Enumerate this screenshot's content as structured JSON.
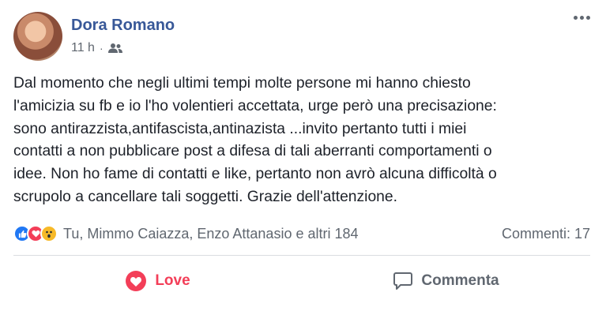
{
  "post": {
    "author": "Dora Romano",
    "time": "11 h",
    "separator": "·",
    "text": "Dal momento che negli ultimi tempi molte persone mi hanno chiesto\nl'amicizia su fb e io l'ho volentieri accettata, urge però una precisazione:\nsono antirazzista,antifascista,antinazista ...invito pertanto tutti i miei\ncontatti a non pubblicare post a difesa di tali aberranti comportamenti o\nidee. Non ho fame di contatti e like, pertanto non avrò alcuna difficoltà o\nscrupolo a cancellare tali soggetti. Grazie dell'attenzione."
  },
  "reactions": {
    "icons": [
      "like-icon",
      "love-icon",
      "wow-icon"
    ],
    "names": "Tu, Mimmo Caiazza, Enzo Attanasio e altri 184",
    "comments": "Commenti: 17"
  },
  "actions": {
    "love_label": "Love",
    "comment_label": "Commenta"
  },
  "colors": {
    "author": "#385898",
    "secondary_text": "#606770",
    "love": "#f33e58",
    "like": "#2078f4",
    "wow": "#f7b928"
  }
}
